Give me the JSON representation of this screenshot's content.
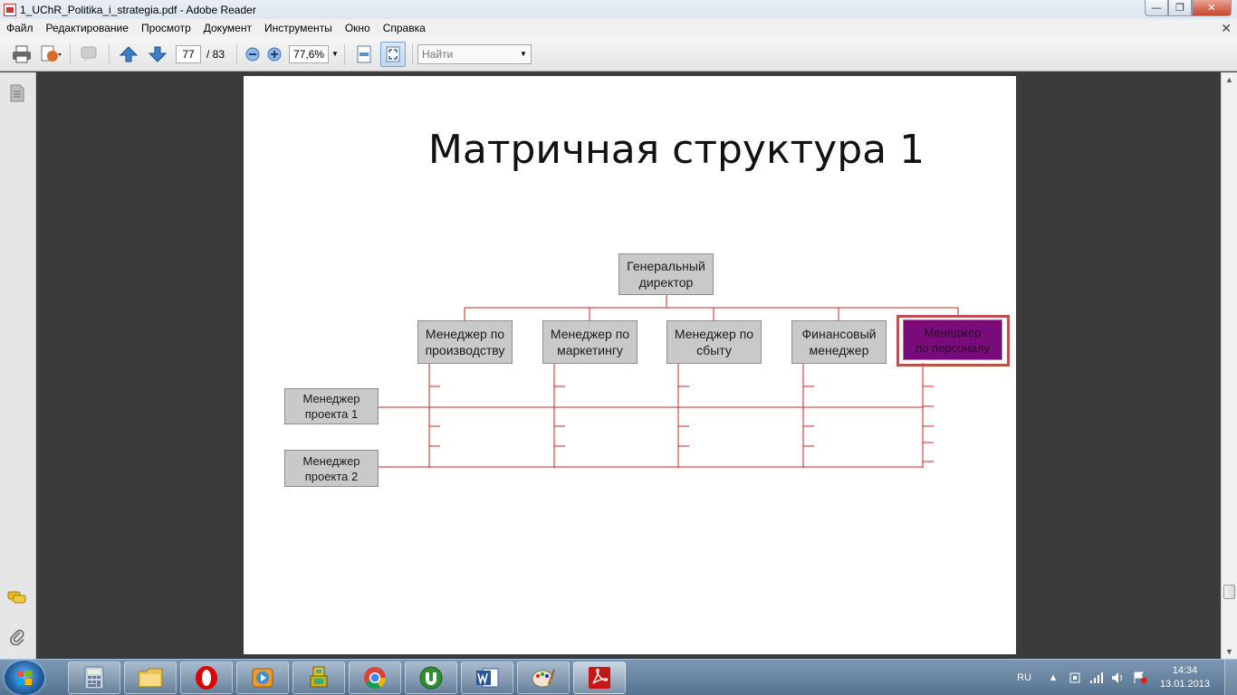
{
  "window": {
    "title": "1_UChR_Politika_i_strategia.pdf - Adobe Reader",
    "minimize_glyph": "—",
    "maximize_glyph": "❐",
    "close_glyph": "✕"
  },
  "menu": {
    "items": [
      "Файл",
      "Редактирование",
      "Просмотр",
      "Документ",
      "Инструменты",
      "Окно",
      "Справка"
    ],
    "close_doc_glyph": "✕"
  },
  "toolbar": {
    "page_current": "77",
    "page_total": "/ 83",
    "zoom": "77,6%",
    "search_placeholder": "Найти"
  },
  "slide": {
    "title": "Матричная структура 1",
    "director": [
      "Генеральный",
      "директор"
    ],
    "managers": [
      [
        "Менеджер по",
        "производству"
      ],
      [
        "Менеджер по",
        "маркетингу"
      ],
      [
        "Менеджер по",
        "сбыту"
      ],
      [
        "Финансовый",
        "менеджер"
      ],
      [
        "Менеджер",
        "по персоналу"
      ]
    ],
    "projects": [
      [
        "Менеджер",
        "проекта 1"
      ],
      [
        "Менеджер",
        "проекта 2"
      ]
    ],
    "highlight_color": "#7a0b7a",
    "line_color": "#cc2222"
  },
  "taskbar": {
    "apps": [
      "calculator-icon",
      "file-explorer-icon",
      "opera-icon",
      "media-player-icon",
      "game-icon",
      "chrome-icon",
      "utorrent-icon",
      "word-icon",
      "paint-icon",
      "adobe-reader-icon"
    ],
    "lang": "RU",
    "time": "14:34",
    "date": "13.01.2013"
  }
}
